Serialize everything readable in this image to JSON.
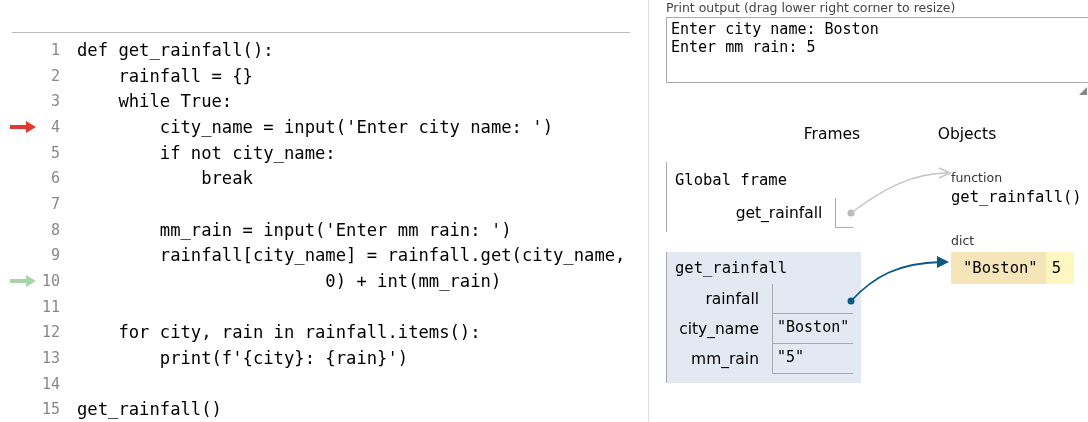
{
  "code": {
    "lines": [
      {
        "number": "1",
        "text": "def get_rainfall():",
        "current": false,
        "next": false
      },
      {
        "number": "2",
        "text": "    rainfall = {}",
        "current": false,
        "next": false
      },
      {
        "number": "3",
        "text": "    while True:",
        "current": false,
        "next": false
      },
      {
        "number": "4",
        "text": "        city_name = input('Enter city name: ')",
        "current": true,
        "next": false
      },
      {
        "number": "5",
        "text": "        if not city_name:",
        "current": false,
        "next": false
      },
      {
        "number": "6",
        "text": "            break",
        "current": false,
        "next": false
      },
      {
        "number": "7",
        "current": false,
        "next": false
      },
      {
        "number": "8",
        "text": "        mm_rain = input('Enter mm rain: ')",
        "current": false,
        "next": false
      },
      {
        "number": "9",
        "text": "        rainfall[city_name] = rainfall.get(city_name,",
        "current": false,
        "next": false
      },
      {
        "number": "10",
        "text": "                        0) + int(mm_rain)",
        "current": false,
        "next": true
      },
      {
        "number": "11",
        "current": false,
        "next": false
      },
      {
        "number": "12",
        "text": "    for city, rain in rainfall.items():",
        "current": false,
        "next": false
      },
      {
        "number": "13",
        "text": "        print(f'{city}: {rain}')",
        "current": false,
        "next": false
      },
      {
        "number": "14",
        "current": false,
        "next": false
      },
      {
        "number": "15",
        "text": "get_rainfall()",
        "current": false,
        "next": false
      }
    ]
  },
  "output": {
    "label": "Print output (drag lower right corner to resize)",
    "lines": [
      "Enter city name: Boston",
      "Enter mm rain: 5"
    ]
  },
  "visualizer": {
    "frames_heading": "Frames",
    "objects_heading": "Objects",
    "frames": [
      {
        "kind": "global",
        "title": "Global frame",
        "variables": [
          {
            "name": "get_rainfall",
            "kind": "pointer"
          }
        ]
      },
      {
        "kind": "active",
        "title": "get_rainfall",
        "variables": [
          {
            "name": "rainfall",
            "kind": "pointer"
          },
          {
            "name": "city_name",
            "kind": "value",
            "value": "\"Boston\""
          },
          {
            "name": "mm_rain",
            "kind": "value",
            "value": "\"5\""
          }
        ]
      }
    ],
    "objects": [
      {
        "kind": "function",
        "type_label": "function",
        "text": "get_rainfall()"
      },
      {
        "kind": "dict",
        "type_label": "dict",
        "entries": [
          {
            "key": "\"Boston\"",
            "value": "5"
          }
        ]
      }
    ]
  }
}
